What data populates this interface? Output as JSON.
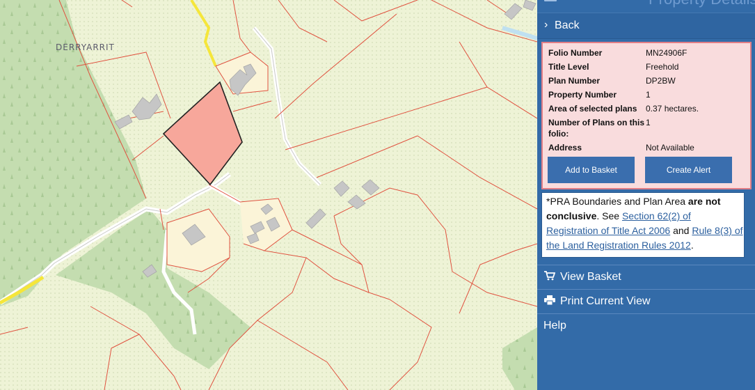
{
  "map": {
    "place_label": "DERRYARRIT"
  },
  "panel": {
    "title": "Property Details",
    "back_label": "Back",
    "details": [
      {
        "key": "Folio Number",
        "value": "MN24906F"
      },
      {
        "key": "Title Level",
        "value": "Freehold"
      },
      {
        "key": "Plan Number",
        "value": "DP2BW"
      },
      {
        "key": "Property Number",
        "value": "1"
      },
      {
        "key": "Area of selected plans",
        "value": "0.37 hectares."
      },
      {
        "key": "Number of Plans on this folio:",
        "value": "1"
      },
      {
        "key": "Address",
        "value": "Not Available"
      }
    ],
    "add_to_basket": "Add to Basket",
    "create_alert": "Create Alert",
    "notice": {
      "prefix": "*PRA Boundaries and Plan Area ",
      "bold": "are not conclusive",
      "see": ". See ",
      "link1": "Section 62(2) of Registration of Title Act 2006",
      "and": " and ",
      "link2": "Rule 8(3) of the Land Registration Rules 2012",
      "end": "."
    },
    "view_basket": "View Basket",
    "print_view": "Print Current View",
    "help": "Help"
  },
  "colors": {
    "panel_bg": "#336ba8",
    "details_bg": "#f9dcdd",
    "details_border": "#e27d85",
    "button_bg": "#3a6eae",
    "selected_parcel": "#f7a79b",
    "boundary": "#e0523f",
    "map_bg": "#eef3d6",
    "forest": "#c4ddb0"
  },
  "icons": [
    "menu-icon",
    "chevron-right-icon",
    "cart-icon",
    "printer-icon"
  ]
}
